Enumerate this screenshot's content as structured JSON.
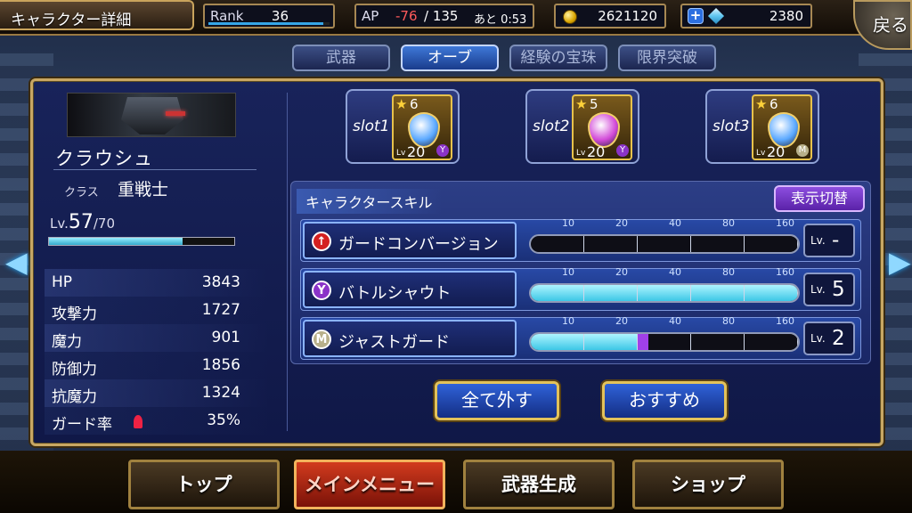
{
  "header": {
    "title": "キャラクター詳細",
    "rank_label": "Rank",
    "rank_value": "36",
    "ap_label": "AP",
    "ap_current": "-76",
    "ap_max": "/ 135",
    "ap_timer": "あと 0:53",
    "gil": "2621120",
    "gems": "2380",
    "back_label": "戻る"
  },
  "tabs": [
    {
      "label": "武器"
    },
    {
      "label": "オーブ"
    },
    {
      "label": "経験の宝珠"
    },
    {
      "label": "限界突破"
    }
  ],
  "character": {
    "name": "クラウシュ",
    "class_label": "クラス",
    "class_value": "重戦士",
    "lv_label": "Lv.",
    "level": "57",
    "level_max": "/70",
    "exp_fraction": 0.72
  },
  "stats": [
    {
      "name": "HP",
      "value": "3843"
    },
    {
      "name": "攻撃力",
      "value": "1727"
    },
    {
      "name": "魔力",
      "value": "901"
    },
    {
      "name": "防御力",
      "value": "1856"
    },
    {
      "name": "抗魔力",
      "value": "1324"
    },
    {
      "name": "ガード率",
      "value": "35%"
    }
  ],
  "slots": [
    {
      "label": "slot1",
      "rarity": "6",
      "lv_label": "Lv",
      "level": "20",
      "gem_color": "#5aa8ff",
      "symbol": "Y",
      "symbol_color": "#8a33c8"
    },
    {
      "label": "slot2",
      "rarity": "5",
      "lv_label": "Lv",
      "level": "20",
      "gem_color": "#d24ad8",
      "symbol": "Y",
      "symbol_color": "#8a33c8"
    },
    {
      "label": "slot3",
      "rarity": "6",
      "lv_label": "Lv",
      "level": "20",
      "gem_color": "#5aa8ff",
      "symbol": "M",
      "symbol_color": "#b8b08a"
    }
  ],
  "skills": {
    "title": "キャラクタースキル",
    "toggle_label": "表示切替",
    "ticks": [
      "10",
      "20",
      "40",
      "80",
      "160"
    ],
    "items": [
      {
        "name": "ガードコンバージョン",
        "icon": "↑",
        "icon_color": "#d42020",
        "lv_label": "Lv.",
        "level": "-",
        "filled": 0,
        "partial": 0
      },
      {
        "name": "バトルシャウト",
        "icon": "Y",
        "icon_color": "#8a33c8",
        "lv_label": "Lv.",
        "level": "5",
        "filled": 5,
        "partial": 0
      },
      {
        "name": "ジャストガード",
        "icon": "M",
        "icon_color": "#b8b08a",
        "lv_label": "Lv.",
        "level": "2",
        "filled": 2,
        "partial": 0.2
      }
    ]
  },
  "actions": {
    "unequip_all": "全て外す",
    "recommend": "おすすめ"
  },
  "nav": [
    {
      "label": "トップ"
    },
    {
      "label": "メインメニュー",
      "active": true
    },
    {
      "label": "武器生成"
    },
    {
      "label": "ショップ"
    }
  ]
}
